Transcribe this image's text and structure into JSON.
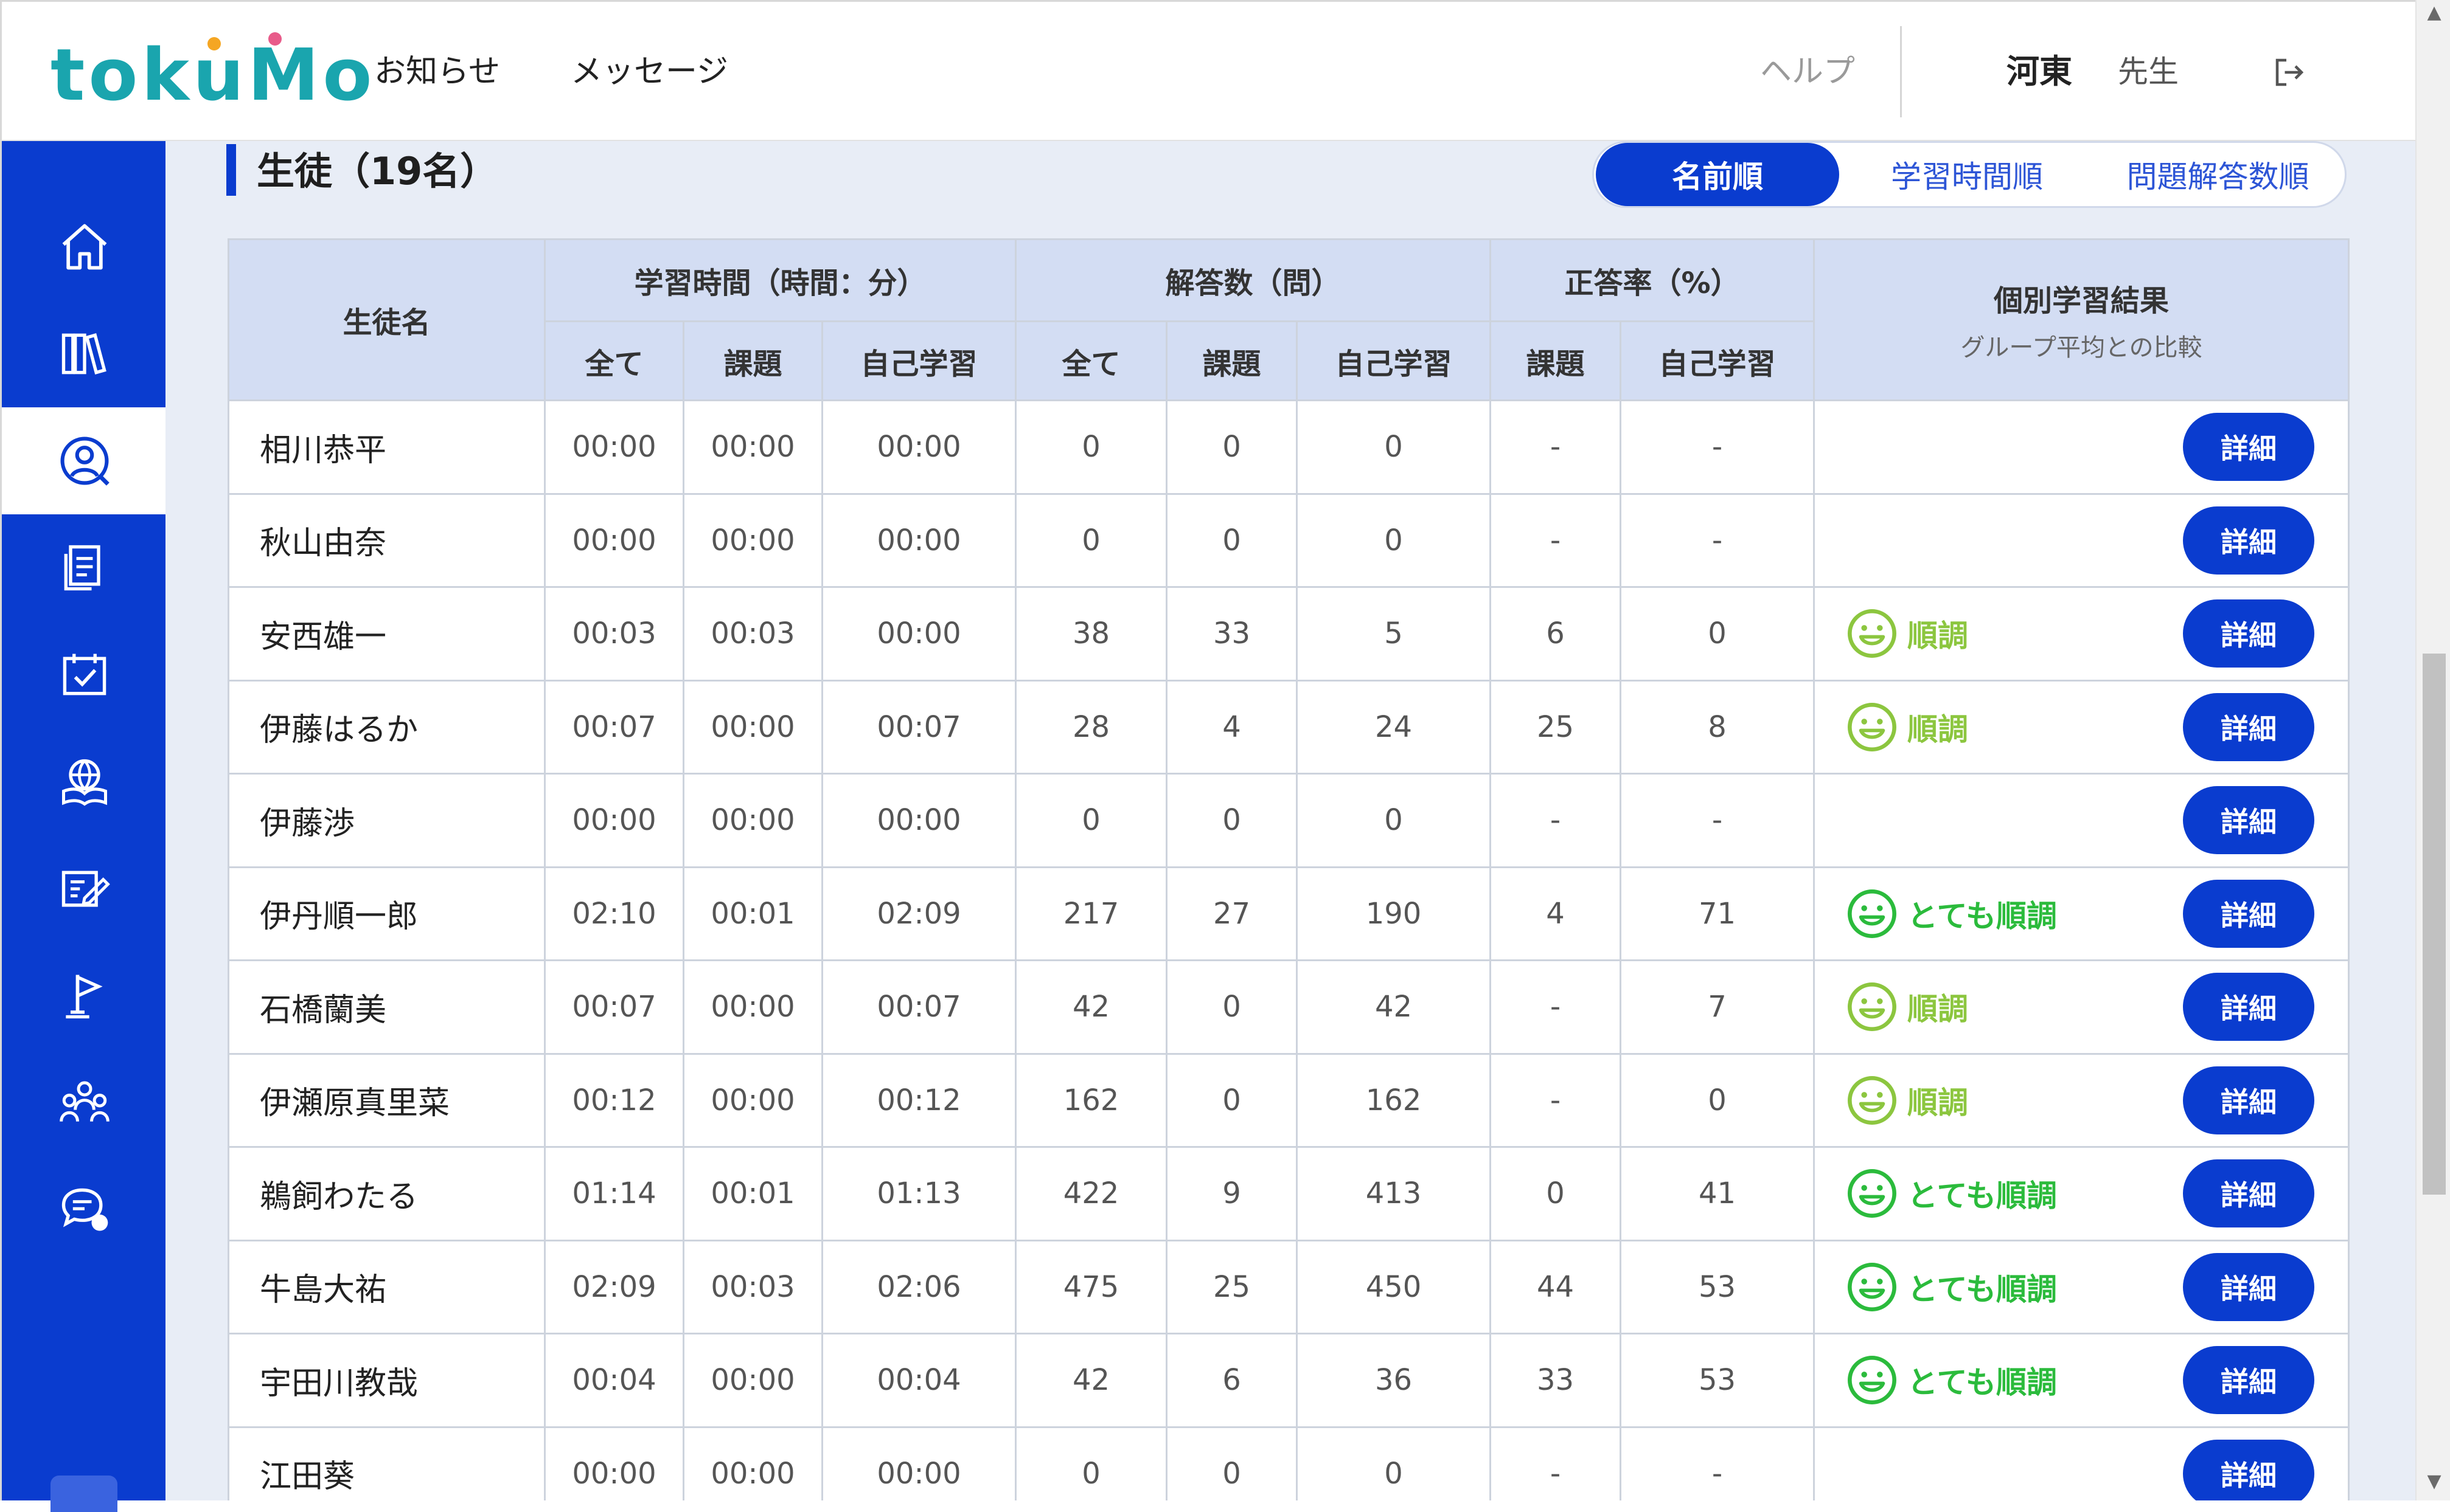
{
  "header": {
    "logo": "tokuMo",
    "nav_news": "お知らせ",
    "nav_messages": "メッセージ",
    "help": "ヘルプ",
    "user_name": "河東",
    "user_role": "先生",
    "logo_colors": [
      "#1aa5ae",
      "#f5a623",
      "#e85b8a"
    ]
  },
  "sidebar": {
    "icons": [
      "home-icon",
      "books-icon",
      "student-icon",
      "worksheet-icon",
      "calendar-check-icon",
      "globe-book-icon",
      "edit-icon",
      "flag-icon",
      "group-icon",
      "chat-icon"
    ],
    "active": "student-icon"
  },
  "section": {
    "title": "生徒（19名）"
  },
  "sort": {
    "options": [
      "名前順",
      "学習時間順",
      "問題解答数順"
    ],
    "active": 0
  },
  "table": {
    "h_name": "生徒名",
    "h_time": "学習時間（時間：分）",
    "h_answers": "解答数（問）",
    "h_rate": "正答率（%）",
    "h_result": "個別学習結果",
    "h_result_sub": "グループ平均との比較",
    "sub_all": "全て",
    "sub_task": "課題",
    "sub_self": "自己学習",
    "detail_label": "詳細",
    "rows": [
      {
        "name": "相川恭平",
        "t_all": "00:00",
        "t_task": "00:00",
        "t_self": "00:00",
        "a_all": "0",
        "a_task": "0",
        "a_self": "0",
        "r_task": "-",
        "r_self": "-",
        "result": ""
      },
      {
        "name": "秋山由奈",
        "t_all": "00:00",
        "t_task": "00:00",
        "t_self": "00:00",
        "a_all": "0",
        "a_task": "0",
        "a_self": "0",
        "r_task": "-",
        "r_self": "-",
        "result": ""
      },
      {
        "name": "安西雄一",
        "t_all": "00:03",
        "t_task": "00:03",
        "t_self": "00:00",
        "a_all": "38",
        "a_task": "33",
        "a_self": "5",
        "r_task": "6",
        "r_self": "0",
        "result": "順調"
      },
      {
        "name": "伊藤はるか",
        "t_all": "00:07",
        "t_task": "00:00",
        "t_self": "00:07",
        "a_all": "28",
        "a_task": "4",
        "a_self": "24",
        "r_task": "25",
        "r_self": "8",
        "result": "順調"
      },
      {
        "name": "伊藤渉",
        "t_all": "00:00",
        "t_task": "00:00",
        "t_self": "00:00",
        "a_all": "0",
        "a_task": "0",
        "a_self": "0",
        "r_task": "-",
        "r_self": "-",
        "result": ""
      },
      {
        "name": "伊丹順一郎",
        "t_all": "02:10",
        "t_task": "00:01",
        "t_self": "02:09",
        "a_all": "217",
        "a_task": "27",
        "a_self": "190",
        "r_task": "4",
        "r_self": "71",
        "result": "とても順調"
      },
      {
        "name": "石橋蘭美",
        "t_all": "00:07",
        "t_task": "00:00",
        "t_self": "00:07",
        "a_all": "42",
        "a_task": "0",
        "a_self": "42",
        "r_task": "-",
        "r_self": "7",
        "result": "順調"
      },
      {
        "name": "伊瀬原真里菜",
        "t_all": "00:12",
        "t_task": "00:00",
        "t_self": "00:12",
        "a_all": "162",
        "a_task": "0",
        "a_self": "162",
        "r_task": "-",
        "r_self": "0",
        "result": "順調"
      },
      {
        "name": "鵜飼わたる",
        "t_all": "01:14",
        "t_task": "00:01",
        "t_self": "01:13",
        "a_all": "422",
        "a_task": "9",
        "a_self": "413",
        "r_task": "0",
        "r_self": "41",
        "result": "とても順調"
      },
      {
        "name": "牛島大祐",
        "t_all": "02:09",
        "t_task": "00:03",
        "t_self": "02:06",
        "a_all": "475",
        "a_task": "25",
        "a_self": "450",
        "r_task": "44",
        "r_self": "53",
        "result": "とても順調"
      },
      {
        "name": "宇田川教哉",
        "t_all": "00:04",
        "t_task": "00:00",
        "t_self": "00:04",
        "a_all": "42",
        "a_task": "6",
        "a_self": "36",
        "r_task": "33",
        "r_self": "53",
        "result": "とても順調"
      },
      {
        "name": "江田葵",
        "t_all": "00:00",
        "t_task": "00:00",
        "t_self": "00:00",
        "a_all": "0",
        "a_task": "0",
        "a_self": "0",
        "r_task": "-",
        "r_self": "-",
        "result": ""
      }
    ]
  },
  "colors": {
    "brand_blue": "#0a3ccf",
    "good": "#8cc63f",
    "very_good": "#2bbb3c"
  }
}
